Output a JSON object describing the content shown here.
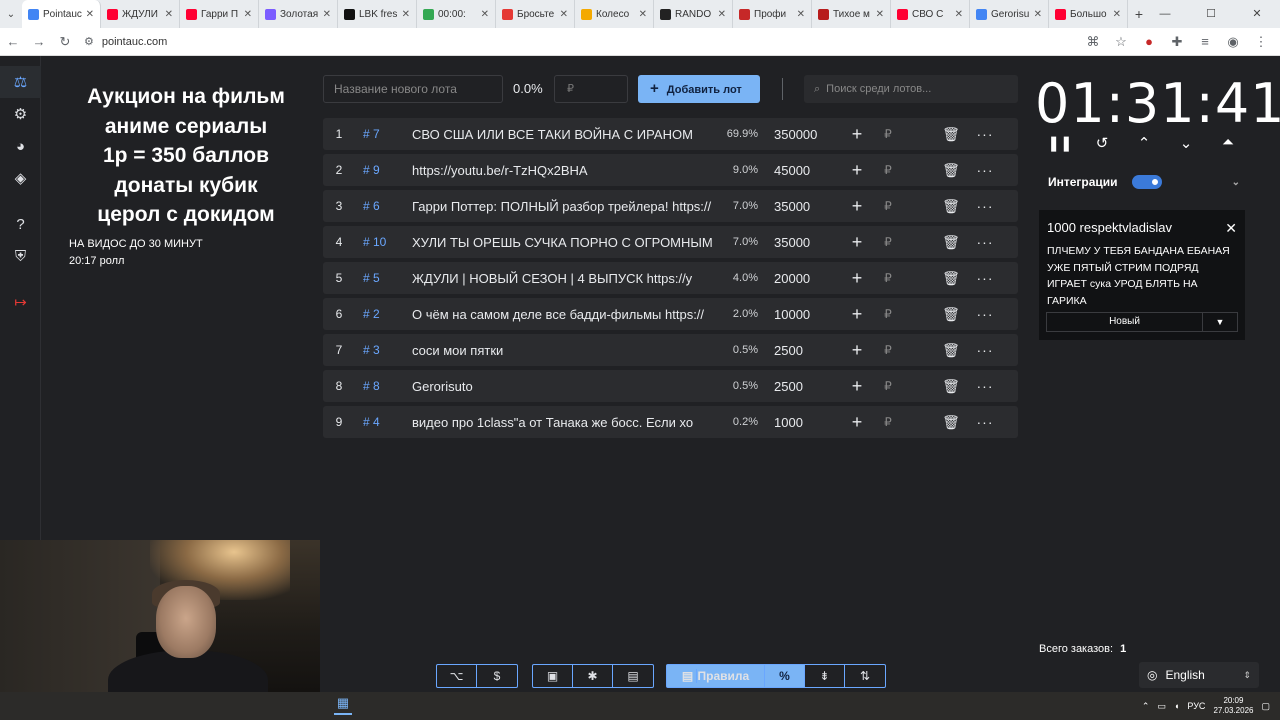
{
  "browser": {
    "tabs": [
      {
        "title": "Pointauc",
        "color": "#4285f4",
        "active": true
      },
      {
        "title": "ЖДУЛИ",
        "color": "#ff0033"
      },
      {
        "title": "Гарри П",
        "color": "#ff0033"
      },
      {
        "title": "Золотая",
        "color": "#7b5cff"
      },
      {
        "title": "LBK fresh",
        "color": "#111111"
      },
      {
        "title": "00:00:",
        "color": "#34a853"
      },
      {
        "title": "Бросьте",
        "color": "#e53935"
      },
      {
        "title": "Колесо",
        "color": "#f4a900"
      },
      {
        "title": "RANDO",
        "color": "#222222"
      },
      {
        "title": "Профи",
        "color": "#c62828"
      },
      {
        "title": "Тихое м",
        "color": "#b71c1c"
      },
      {
        "title": "СВО С",
        "color": "#ff0033"
      },
      {
        "title": "Gerorisu",
        "color": "#4285f4"
      },
      {
        "title": "Большо",
        "color": "#ff0033"
      }
    ],
    "url": "pointauc.com"
  },
  "sidebar": {
    "items": [
      {
        "icon": "gavel-icon",
        "glyph": "⚖",
        "active": true
      },
      {
        "icon": "gear-icon",
        "glyph": "⚙"
      },
      {
        "icon": "wheel-icon",
        "glyph": "◕"
      },
      {
        "icon": "layers-icon",
        "glyph": "◈"
      },
      {
        "icon": "help-icon",
        "glyph": "?"
      },
      {
        "icon": "shield-icon",
        "glyph": "⛨"
      },
      {
        "icon": "logout-icon",
        "glyph": "↦"
      }
    ]
  },
  "header": {
    "title_lines": [
      "Аукцион на фильм",
      "аниме сериалы",
      "1р = 350 баллов",
      "донаты кубик",
      "церол с докидом"
    ],
    "notes": [
      "НА ВИДОС ДО 30 МИНУТ",
      "20:17 ролл"
    ]
  },
  "controls": {
    "lot_name_placeholder": "Название нового лота",
    "percent": "0.0%",
    "price_placeholder": "₽",
    "add_label": "Добавить лот",
    "search_placeholder": "Поиск среди лотов..."
  },
  "lots": [
    {
      "idx": "1",
      "num": "# 7",
      "name": "СВО США ИЛИ ВСЕ ТАКИ ВОЙНА С ИРАНОМ",
      "pct": "69.9%",
      "amount": "350000"
    },
    {
      "idx": "2",
      "num": "# 9",
      "name": "https://youtu.be/r-TzHQx2BHA",
      "pct": "9.0%",
      "amount": "45000"
    },
    {
      "idx": "3",
      "num": "# 6",
      "name": "Гарри Поттер: ПОЛНЫЙ разбор трейлера! https://",
      "pct": "7.0%",
      "amount": "35000"
    },
    {
      "idx": "4",
      "num": "# 10",
      "name": "ХУЛИ ТЫ ОРЕШЬ СУЧКА ПОРНО С ОГРОМНЫМ",
      "pct": "7.0%",
      "amount": "35000"
    },
    {
      "idx": "5",
      "num": "# 5",
      "name": "ЖДУЛИ | НОВЫЙ СЕЗОН | 4 ВЫПУСК https://y",
      "pct": "4.0%",
      "amount": "20000"
    },
    {
      "idx": "6",
      "num": "# 2",
      "name": " О чём на самом деле все бадди-фильмы https://",
      "pct": "2.0%",
      "amount": "10000"
    },
    {
      "idx": "7",
      "num": "# 3",
      "name": "соси мои пятки",
      "pct": "0.5%",
      "amount": "2500"
    },
    {
      "idx": "8",
      "num": "# 8",
      "name": "Gerorisuto",
      "pct": "0.5%",
      "amount": "2500"
    },
    {
      "idx": "9",
      "num": "# 4",
      "name": "видео про 1class\"а от Танака же босс. Если хо",
      "pct": "0.2%",
      "amount": "1000"
    }
  ],
  "timer": {
    "value": "01:31:41"
  },
  "integrations": {
    "label": "Интеграции",
    "enabled": true
  },
  "donation": {
    "header": "1000 respektvladislav",
    "message": "ПЛЧЕМУ У ТЕБЯ БАНДАНА ЕБАНАЯ УЖЕ ПЯТЫЙ СТРИМ ПОДРЯД ИГРАЕТ сука УРОД БЛЯТЬ НА ГАРИКА",
    "select_value": "Новый"
  },
  "orders": {
    "label": "Всего заказов:",
    "count": "1"
  },
  "language": {
    "value": "English"
  },
  "bottom_bar": {
    "rules_label": "Правила"
  },
  "taskbar": {
    "lang": "РУС",
    "time": "20:09",
    "date": "27.03.2026"
  }
}
